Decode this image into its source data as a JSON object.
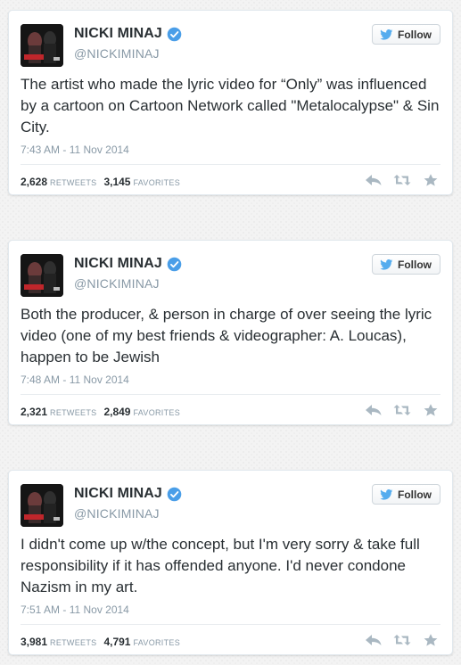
{
  "colors": {
    "verified_badge": "#4a9ee8",
    "twitter_blue": "#55acee",
    "text_primary": "#292f33",
    "text_secondary": "#8899a6",
    "action_icons": "#aab8c2"
  },
  "tweets": [
    {
      "author_name": "NICKI MINAJ",
      "author_handle": "@NICKIMINAJ",
      "follow_label": "Follow",
      "text": "The artist who made the lyric video for “Only” was influenced by a cartoon on Cartoon Network called \"Metalocalypse\" & Sin City.",
      "timestamp": "7:43 AM - 11 Nov 2014",
      "retweets_count": "2,628",
      "retweets_label": "RETWEETS",
      "favorites_count": "3,145",
      "favorites_label": "FAVORITES",
      "icons": [
        "avatar",
        "verified-badge-icon",
        "twitter-bird-icon",
        "reply-icon",
        "retweet-icon",
        "favorite-star-icon"
      ]
    },
    {
      "author_name": "NICKI MINAJ",
      "author_handle": "@NICKIMINAJ",
      "follow_label": "Follow",
      "text": "Both the producer, & person in charge of over seeing the lyric video (one of my best friends & videographer: A. Loucas), happen to be Jewish",
      "timestamp": "7:48 AM - 11 Nov 2014",
      "retweets_count": "2,321",
      "retweets_label": "RETWEETS",
      "favorites_count": "2,849",
      "favorites_label": "FAVORITES",
      "icons": [
        "avatar",
        "verified-badge-icon",
        "twitter-bird-icon",
        "reply-icon",
        "retweet-icon",
        "favorite-star-icon"
      ]
    },
    {
      "author_name": "NICKI MINAJ",
      "author_handle": "@NICKIMINAJ",
      "follow_label": "Follow",
      "text": "I didn't come up w/the concept, but I'm very sorry & take full responsibility if it has offended anyone. I'd never condone Nazism in my art.",
      "timestamp": "7:51 AM - 11 Nov 2014",
      "retweets_count": "3,981",
      "retweets_label": "RETWEETS",
      "favorites_count": "4,791",
      "favorites_label": "FAVORITES",
      "icons": [
        "avatar",
        "verified-badge-icon",
        "twitter-bird-icon",
        "reply-icon",
        "retweet-icon",
        "favorite-star-icon"
      ]
    }
  ]
}
